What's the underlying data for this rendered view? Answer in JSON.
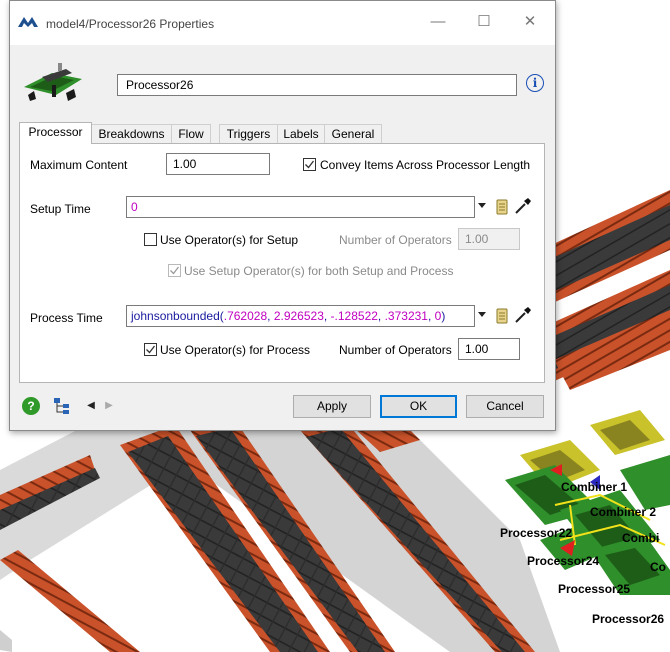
{
  "window": {
    "title": "model4/Processor26  Properties",
    "min_glyph": "—",
    "max_glyph": "☐",
    "close_glyph": "✕"
  },
  "header": {
    "object_name": "Processor26",
    "info_glyph": "i"
  },
  "tabs": [
    {
      "label": "Processor",
      "active": true
    },
    {
      "label": "Breakdowns",
      "active": false
    },
    {
      "label": "Flow",
      "active": false
    },
    {
      "label": "Triggers",
      "active": false
    },
    {
      "label": "Labels",
      "active": false
    },
    {
      "label": "General",
      "active": false
    }
  ],
  "processor": {
    "max_content_label": "Maximum Content",
    "max_content_value": "1.00",
    "convey_label": "Convey Items Across Processor Length",
    "convey_checked": true,
    "setup_time_label": "Setup Time",
    "setup_time_value": "0",
    "use_operator_setup_label": "Use Operator(s) for Setup",
    "use_operator_setup_checked": false,
    "setup_num_operators_label": "Number of Operators",
    "setup_num_operators_value": "1.00",
    "use_setup_both_label": "Use Setup Operator(s) for both Setup and Process",
    "use_setup_both_checked": true,
    "process_time_label": "Process Time",
    "process_time_fn": "johnsonbounded(",
    "process_time_args": [
      ".762028",
      "2.926523",
      "-.128522",
      ".373231",
      "0"
    ],
    "process_time_close": ")",
    "use_operator_process_label": "Use Operator(s) for Process",
    "use_operator_process_checked": true,
    "process_num_operators_label": "Number of Operators",
    "process_num_operators_value": "1.00"
  },
  "buttons": {
    "apply": "Apply",
    "ok": "OK",
    "cancel": "Cancel",
    "help_glyph": "?",
    "prev_glyph": "◀",
    "next_glyph": "▶"
  },
  "scene_labels": [
    "Combiner 1",
    "Combiner 2",
    "Processor22",
    "Combi",
    "Processor24",
    "Co",
    "Processor25",
    "Processor26"
  ],
  "colors": {
    "accent": "#0078d7",
    "code_number": "#c000c0",
    "conveyor_dark": "#333333",
    "conveyor_rail": "#d25a2a",
    "machine_green": "#2f8f2a",
    "machine_yellow": "#c9c22a"
  }
}
